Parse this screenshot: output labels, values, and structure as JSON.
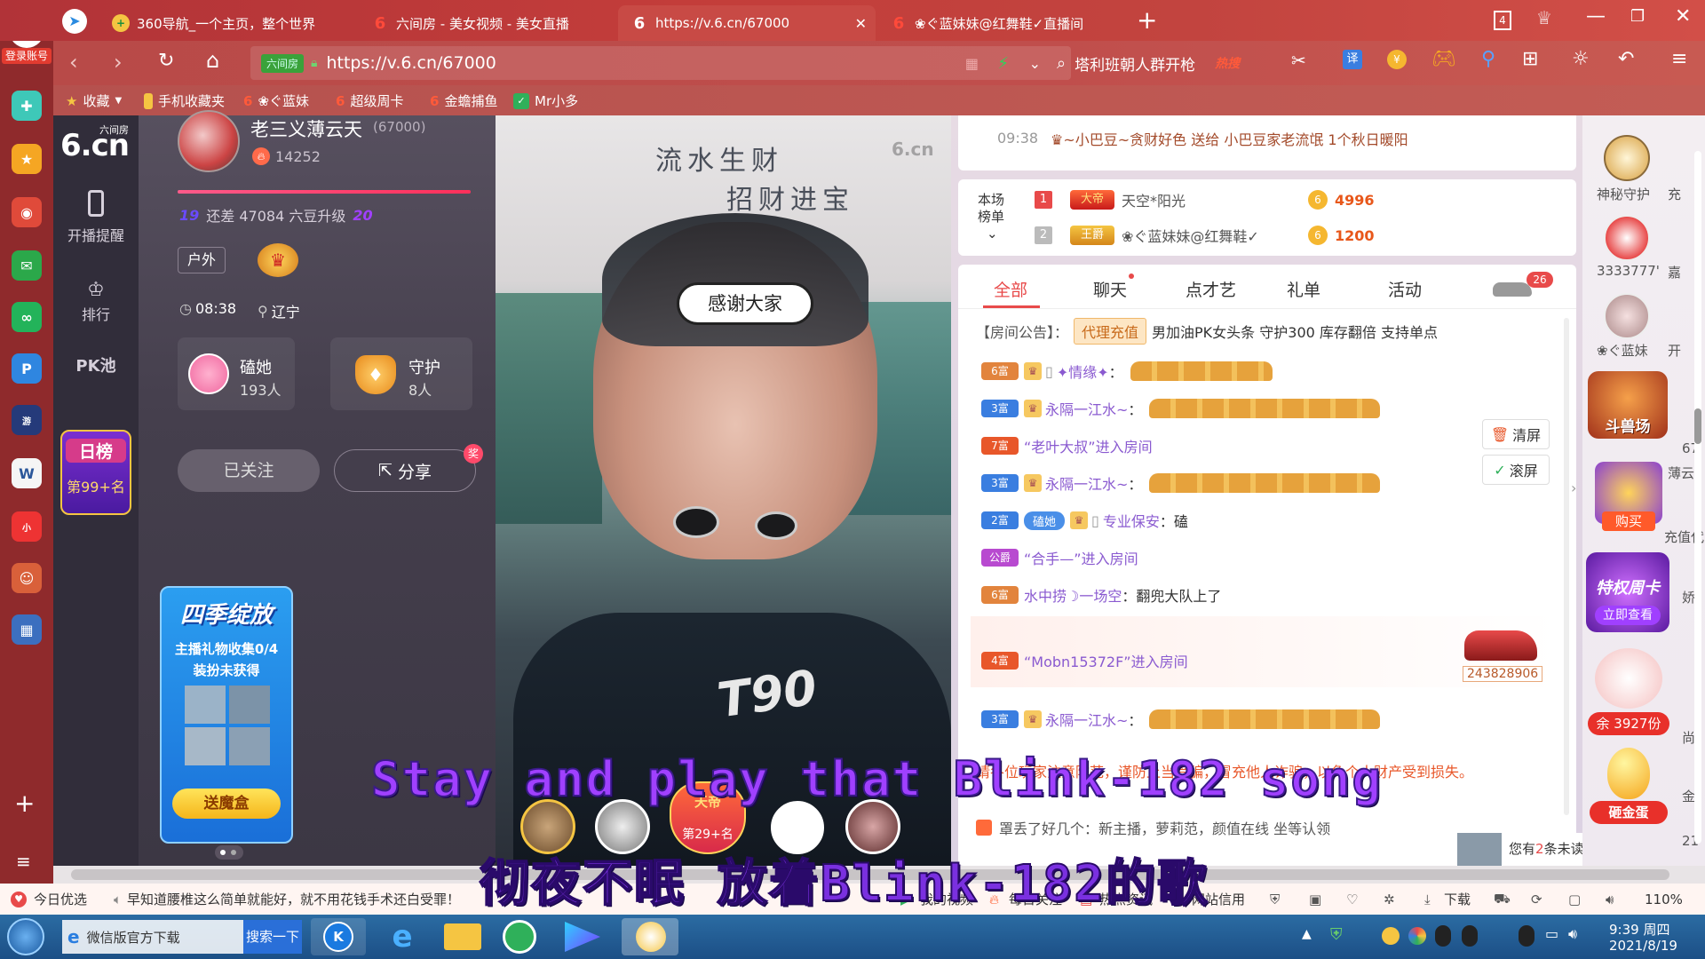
{
  "browser": {
    "account_label": "登录账号",
    "tabs": [
      {
        "title": "360导航_一个主页，整个世界"
      },
      {
        "title": "六间房 - 美女视频 - 美女直播"
      },
      {
        "title": "https://v.6.cn/67000"
      },
      {
        "title": "❀ぐ蓝妹妹@红舞鞋✓直播间"
      }
    ],
    "tab_count": "4",
    "address_site_badge": "六间房",
    "url": "https://v.6.cn/67000",
    "search_text": "塔利班朝人群开枪",
    "search_hot": "热搜",
    "translate_label": "译",
    "bookmarks": [
      {
        "label": "收藏"
      },
      {
        "label": "手机收藏夹"
      },
      {
        "label": "❀ぐ蓝妹"
      },
      {
        "label": "超级周卡"
      },
      {
        "label": "金蟾捕鱼"
      },
      {
        "label": "Mr小多"
      }
    ]
  },
  "site_nav": {
    "logo_top": "六间房",
    "logo_main": "6.cn",
    "items": [
      {
        "label": "开播提醒"
      },
      {
        "label": "排行"
      },
      {
        "label": "PK池"
      }
    ],
    "daily_rank_label": "日榜",
    "daily_rank_value": "第99+名"
  },
  "host": {
    "name": "老三义薄云天",
    "room_id": "(67000)",
    "fans": "14252",
    "level_from": "19",
    "level_text": "还差 47084 六豆升级",
    "level_to": "20",
    "tag": "户外",
    "time": "08:38",
    "location": "辽宁",
    "fan_club_name": "磕她",
    "fan_club_count": "193人",
    "guard_label": "守护",
    "guard_count": "8人",
    "follow_label": "已关注",
    "share_label": "分享",
    "share_badge": "奖",
    "promo_title": "四季绽放",
    "promo_line1": "主播礼物收集0/4",
    "promo_line2": "装扮未获得",
    "promo_button": "送魔盒"
  },
  "video": {
    "calligraphy_1": "流水生财",
    "calligraphy_2": "招财进宝",
    "watermark": "6.cn",
    "bubble_text": "感谢大家",
    "shirt_text": "T90",
    "badge_rank": "第29+名",
    "badge_title": "天帝"
  },
  "chat_top": {
    "time": "09:38",
    "gift_message": "♛~小巴豆~贪财好色 送给 小巴豆家老流氓 1个秋日暖阳"
  },
  "ranking": {
    "label_line1": "本场",
    "label_line2": "榜单",
    "rows": [
      {
        "rank": "1",
        "title": "大帝",
        "name": "天空*阳光",
        "score": "4996"
      },
      {
        "rank": "2",
        "title": "王爵",
        "name": "❀ぐ蓝妹妹@红舞鞋✓",
        "score": "1200"
      }
    ]
  },
  "chat_tabs": [
    {
      "label": "全部"
    },
    {
      "label": "聊天"
    },
    {
      "label": "点才艺"
    },
    {
      "label": "礼单"
    },
    {
      "label": "活动"
    }
  ],
  "car_badge": "26",
  "announcement": {
    "prefix": "【房间公告】：",
    "tag": "代理充值",
    "text": "男加油PK女头条 守护300 库存翻倍 支持单点"
  },
  "messages": [
    {
      "level": "6富",
      "user": "✦情缘✦",
      "suffix": "：",
      "type": "flowers",
      "count": 6
    },
    {
      "level": "3富",
      "user": "永隔一江水~",
      "suffix": "：",
      "type": "flowers",
      "count": 10
    },
    {
      "level": "7富",
      "user": "",
      "text": "“老叶大叔”进入房间",
      "type": "enter"
    },
    {
      "level": "3富",
      "user": "永隔一江水~",
      "suffix": "：",
      "type": "flowers",
      "count": 10
    },
    {
      "level": "2富",
      "fan": "磕她",
      "user": "专业保安",
      "suffix": "：磕",
      "type": "chat"
    },
    {
      "level": "公爵",
      "user": "",
      "text": "“合手—”进入房间",
      "type": "enter"
    },
    {
      "level": "6富",
      "user": "水中捞☽一场空",
      "suffix": "：翻兜大队上了",
      "type": "chat"
    },
    {
      "level": "4富",
      "user": "",
      "text": "“Mobn15372F”进入房间",
      "type": "enter"
    },
    {
      "level": "3富",
      "user": "永隔一江水~",
      "suffix": "：",
      "type": "flowers",
      "count": 10
    }
  ],
  "car_number": "243828906",
  "notice_text": "请各位玩家注意防范，谨防上当受骗，冒充他人诈骗，以免个人财产受到损失。",
  "side_buttons": {
    "clear": "清屏",
    "scroll": "滚屏"
  },
  "chat_bottom_text": "罩丢了好几个：新主播，萝莉范，颜值在线 坐等认领",
  "unread": {
    "prefix": "您有",
    "count": "2",
    "suffix": "条未读消息"
  },
  "right_strip": {
    "guards": [
      {
        "label": "神秘守护"
      },
      {
        "label": "3333777'"
      },
      {
        "label": "❀ぐ蓝妹"
      }
    ],
    "arena": "斗兽场",
    "buy": "购买",
    "privilege": "特权周卡",
    "view_now": "立即查看",
    "remaining": "余 3927份",
    "egg": "砸金蛋",
    "partial_labels": [
      "充",
      "嘉",
      "开",
      "67",
      "薄云",
      "充值代",
      "娇",
      "尚",
      "金",
      "21"
    ]
  },
  "subtitles": {
    "english": "Stay and play that Blink-182 song",
    "chinese": "彻夜不眠 放着Blink-182的歌"
  },
  "statusbar": {
    "left_today": "今日优选",
    "headline": "早知道腰椎这么简单就能好，就不用花钱手术还白受罪！",
    "items": [
      {
        "label": "我的视频"
      },
      {
        "label": "每日关注"
      },
      {
        "label": "热点资讯"
      },
      {
        "label": "网站信用"
      },
      {
        "label": "下载"
      }
    ],
    "zoom": "110%"
  },
  "taskbar": {
    "wechat_item": "微信版官方下载",
    "search_button": "搜索一下",
    "time": "9:39 周四",
    "date": "2021/8/19"
  }
}
